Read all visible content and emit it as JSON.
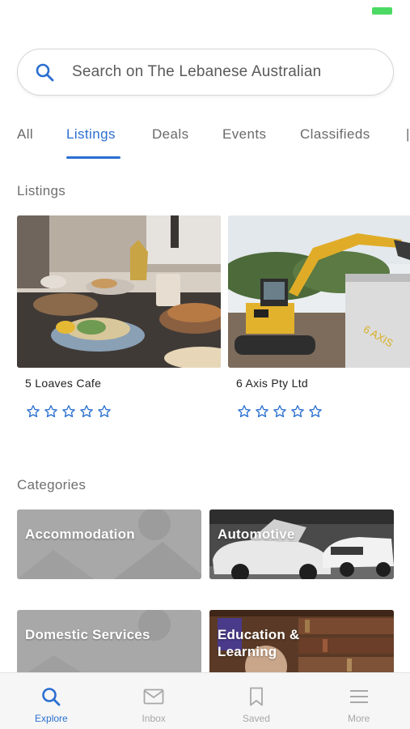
{
  "search": {
    "placeholder": "Search on The Lebanese Australian"
  },
  "tabs": [
    {
      "label": "All"
    },
    {
      "label": "Listings",
      "active": true
    },
    {
      "label": "Deals"
    },
    {
      "label": "Events"
    },
    {
      "label": "Classifieds"
    }
  ],
  "listings_section": {
    "title": "Listings"
  },
  "listings": [
    {
      "name": "5 Loaves Cafe",
      "rating": 0,
      "max_rating": 5
    },
    {
      "name": "6 Axis Pty Ltd",
      "rating": 0,
      "max_rating": 5
    }
  ],
  "categories_section": {
    "title": "Categories"
  },
  "categories": [
    {
      "label": "Accommodation"
    },
    {
      "label": "Automotive"
    },
    {
      "label": "Domestic Services"
    },
    {
      "label": "Education & Learning"
    }
  ],
  "bottom_nav": [
    {
      "label": "Explore",
      "icon": "search-icon",
      "active": true
    },
    {
      "label": "Inbox",
      "icon": "mail-icon"
    },
    {
      "label": "Saved",
      "icon": "bookmark-icon"
    },
    {
      "label": "More",
      "icon": "menu-icon"
    }
  ],
  "colors": {
    "accent": "#2a6fd0",
    "status_battery": "#4cd964"
  },
  "excavator_decal": "6 AXIS"
}
